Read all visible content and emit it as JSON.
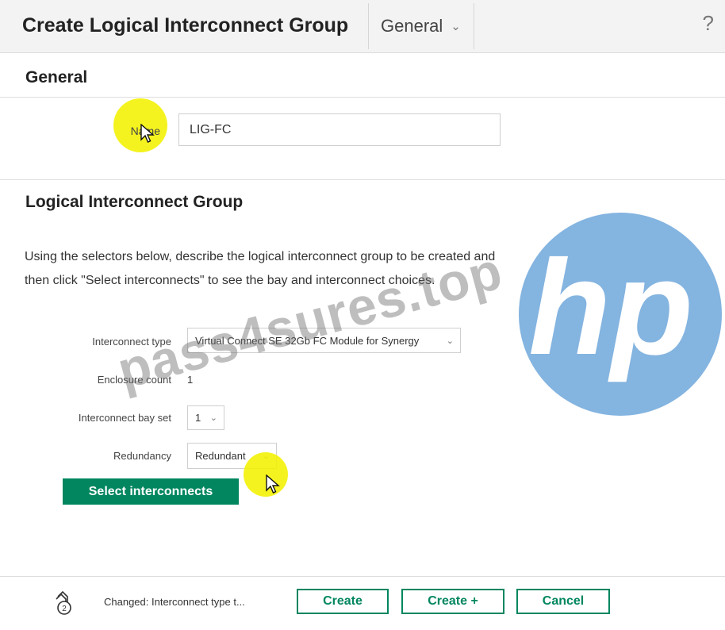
{
  "header": {
    "title": "Create Logical Interconnect Group",
    "view_select": "General",
    "help": "?"
  },
  "general": {
    "heading": "General",
    "name_label": "Name",
    "name_value": "LIG-FC"
  },
  "lig": {
    "heading": "Logical Interconnect Group",
    "description": "Using the selectors below, describe the logical interconnect group to be created and then click \"Select interconnects\" to see the bay and interconnect choices.",
    "interconnect_type_label": "Interconnect type",
    "interconnect_type_value": "Virtual Connect SE 32Gb FC Module for Synergy",
    "enclosure_count_label": "Enclosure count",
    "enclosure_count_value": "1",
    "bay_set_label": "Interconnect bay set",
    "bay_set_value": "1",
    "redundancy_label": "Redundancy",
    "redundancy_value": "Redundant",
    "select_interconnects_button": "Select interconnects"
  },
  "footer": {
    "changes_count": "2",
    "changes_text": "Changed: Interconnect type t...",
    "create_button": "Create",
    "create_plus_button": "Create +",
    "cancel_button": "Cancel"
  },
  "overlay": {
    "watermark": "pass4sures.top",
    "logo_text": "hp"
  },
  "colors": {
    "accent": "#01865f",
    "highlight": "#f3f100",
    "logo": "#5b9bd5"
  }
}
